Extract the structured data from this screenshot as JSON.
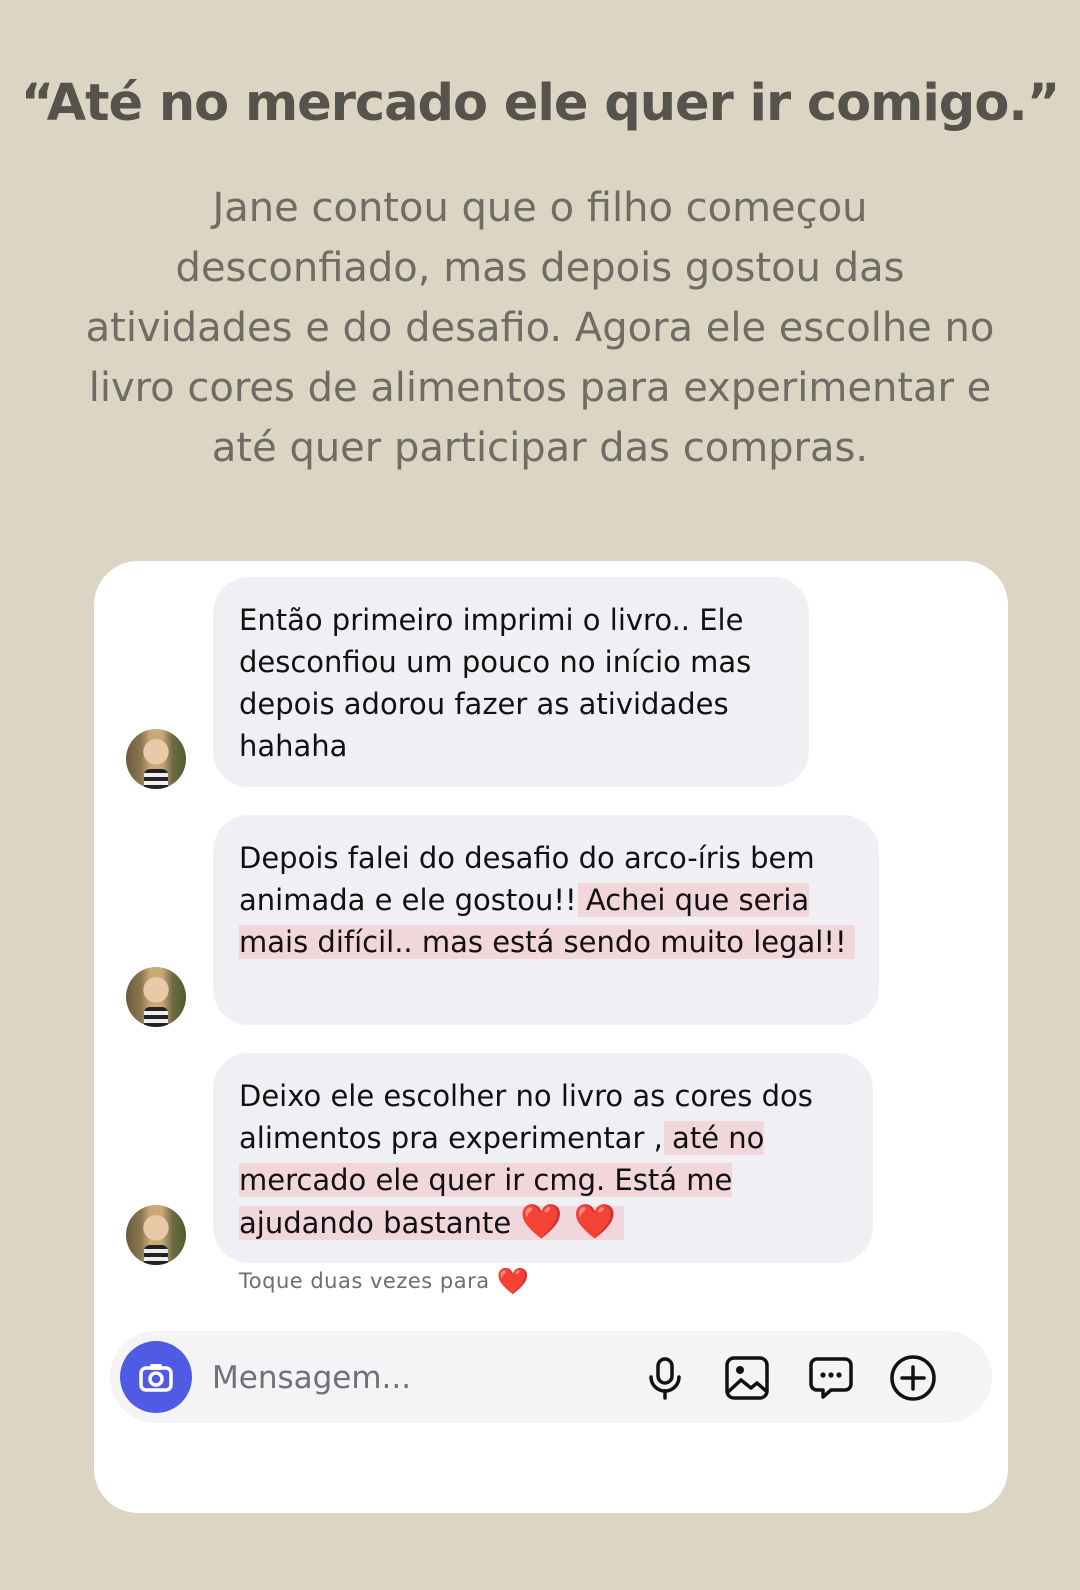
{
  "headline": "“Até no mercado ele quer ir comigo.”",
  "subtitle": "Jane contou que o filho começou desconfiado, mas depois gostou das atividades e do desafio. Agora ele escolhe no livro cores de alimentos para experimentar e até quer participar das compras.",
  "messages": [
    {
      "text": "Então primeiro imprimi o livro.. Ele desconfiou um pouco no início mas depois adorou fazer as atividades hahaha"
    },
    {
      "text": "Depois falei do desafio do arco-íris bem animada e ele gostou!!",
      "highlight": "Achei que seria mais difícil.. mas está sendo muito legal!!"
    },
    {
      "text": "Deixo ele escolher no livro as cores dos alimentos pra experimentar ,",
      "highlight": "até no mercado ele quer ir cmg. Está me ajudando bastante",
      "emoji": "❤️ ❤️"
    }
  ],
  "reaction_hint": {
    "text": "Toque duas vezes para",
    "icon": "heart-icon",
    "emoji": "❤️"
  },
  "composer": {
    "placeholder": "Mensagem...",
    "icons": [
      "camera-icon",
      "microphone-icon",
      "image-icon",
      "sticker-icon",
      "plus-icon"
    ],
    "camera_color": "#4f5be4"
  },
  "colors": {
    "background": "#ddd5c3",
    "bubble": "#efeff4",
    "highlight": "#f1d6dc"
  }
}
